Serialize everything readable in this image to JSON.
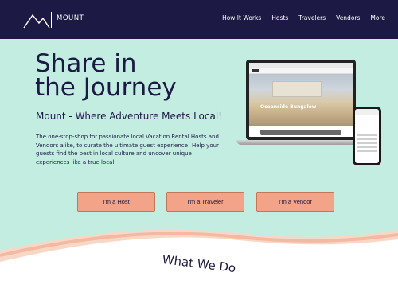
{
  "nav": {
    "brand": "MOUNT",
    "links": [
      "How It Works",
      "Hosts",
      "Travelers",
      "Vendors",
      "More"
    ],
    "bg": "#1c1a44"
  },
  "hero": {
    "headline_line1": "Share in",
    "headline_line2": "the Journey",
    "subhead": "Mount - Where Adventure Meets Local!",
    "body": "The one-stop-shop for passionate local Vacation Rental Hosts and Vendors alike, to curate the ultimate guest experience! Help your guests find the best in local culture and uncover unique experiences like a true local!",
    "bg": "#c4ede1"
  },
  "mockup": {
    "laptop_caption": "Oceanside Bungalow"
  },
  "buttons": {
    "host": "I'm a Host",
    "traveler": "I'm a Traveler",
    "vendor": "I'm a Vendor",
    "color": "#f2a388"
  },
  "section": {
    "title": "What We Do"
  }
}
